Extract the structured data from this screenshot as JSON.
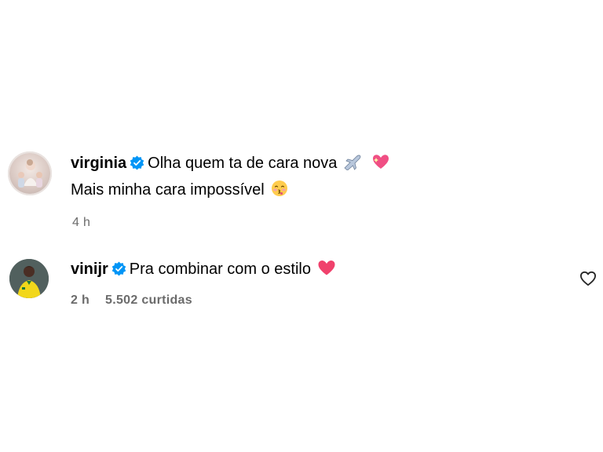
{
  "comments": [
    {
      "username": "virginia",
      "text_line1": "Olha quem ta de cara nova",
      "text_line2": "Mais minha cara impossível",
      "time": "4 h",
      "verified": true,
      "emojis": [
        "airplane-emoji",
        "sparkling-heart-emoji",
        "kissing-face-emoji"
      ]
    },
    {
      "username": "vinijr",
      "text": "Pra combinar com o estilo",
      "time": "2 h",
      "likes": "5.502 curtidas",
      "verified": true,
      "emojis": [
        "heart-emoji"
      ]
    }
  ],
  "icons": {
    "verified": "verified-badge-icon",
    "like": "heart-outline-icon"
  },
  "colors": {
    "verified_blue": "#0095f6",
    "meta_gray": "#6b6b6b"
  }
}
